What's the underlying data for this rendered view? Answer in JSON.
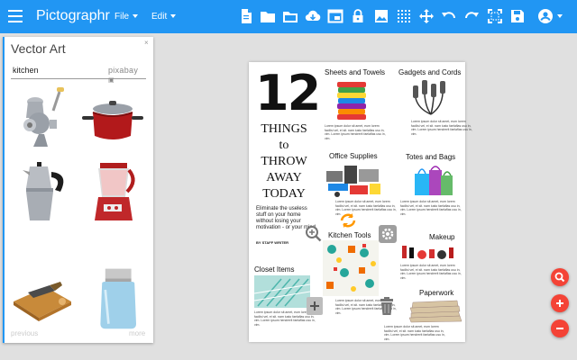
{
  "app": {
    "title": "Pictographr",
    "menus": [
      {
        "label": "File"
      },
      {
        "label": "Edit"
      }
    ],
    "toolbar_icons": [
      "new-document-icon",
      "folder-icon",
      "open-folder-icon",
      "cloud-download-icon",
      "window-icon",
      "lock-icon",
      "image-icon",
      "grid-icon",
      "move-icon",
      "undo-icon",
      "redo-icon",
      "fullscreen-icon",
      "save-icon",
      "account-icon"
    ],
    "accent_color": "#2196f3",
    "fab_color": "#f44336"
  },
  "panel": {
    "title": "Vector Art",
    "close_glyph": "×",
    "search": {
      "value": "kitchen",
      "provider": "pixabay"
    },
    "results": [
      "meat-grinder",
      "cooking-pot",
      "moka-pot",
      "blender",
      "cutting-board",
      "mason-jar"
    ],
    "prev_label": "previous",
    "more_label": "more"
  },
  "poster": {
    "hero_number": "12",
    "hero_lines": [
      "THINGS",
      "to",
      "THROW",
      "AWAY",
      "TODAY"
    ],
    "hero_subtitle": "Eliminate the useless stuff on your home without losing your motivation - or your mind.",
    "byline": "BY STAFF WRITER",
    "sections": [
      {
        "title": "Sheets and Towels"
      },
      {
        "title": "Gadgets and Cords"
      },
      {
        "title": "Office Supplies"
      },
      {
        "title": "Totes and Bags"
      },
      {
        "title": "Kitchen Tools"
      },
      {
        "title": "Makeup"
      },
      {
        "title": "Closet Items"
      },
      {
        "title": "Paperwork"
      }
    ],
    "lorem": "Lorem ipsum dolor sit amet, eum lorem facilisi vel, ei sit. nam iusto faelaflas usu in, vim. Lorem ipsum hendrerit faelaflas usu in, vim."
  }
}
